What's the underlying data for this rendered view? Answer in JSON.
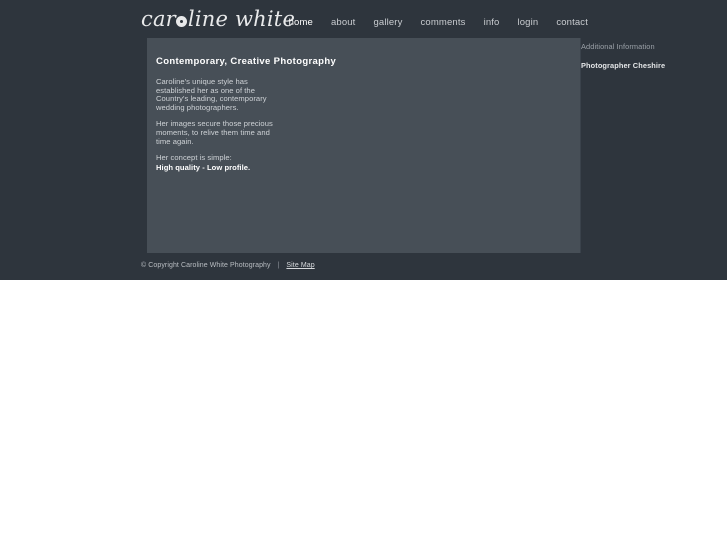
{
  "site": {
    "logo_prefix": "car",
    "logo_suffix": "line white",
    "logo_full": "caroline white"
  },
  "nav": {
    "items": [
      {
        "label": "home",
        "active": true
      },
      {
        "label": "about",
        "active": false
      },
      {
        "label": "gallery",
        "active": false
      },
      {
        "label": "comments",
        "active": false
      },
      {
        "label": "info",
        "active": false
      },
      {
        "label": "login",
        "active": false
      },
      {
        "label": "contact",
        "active": false
      }
    ]
  },
  "main": {
    "heading": "Contemporary, Creative Photography",
    "paragraphs": [
      "Caroline's unique style has established her as one of the Country's leading, contemporary wedding photographers.",
      "Her images secure those precious moments, to relive them time and time again.",
      "Her concept is simple:"
    ],
    "tagline": "High quality - Low profile."
  },
  "sidebar": {
    "title": "Additional Information",
    "links": [
      {
        "label": "Photographer Cheshire"
      }
    ]
  },
  "footer": {
    "copyright": "© Copyright Caroline White Photography",
    "separator": "|",
    "sitemap_label": "Site Map"
  },
  "colors": {
    "page_background": "#2e353d",
    "panel_background": "#474f57",
    "text_primary": "#ffffff",
    "text_muted": "#ced2d6",
    "nav_text": "#c8cbcf"
  }
}
